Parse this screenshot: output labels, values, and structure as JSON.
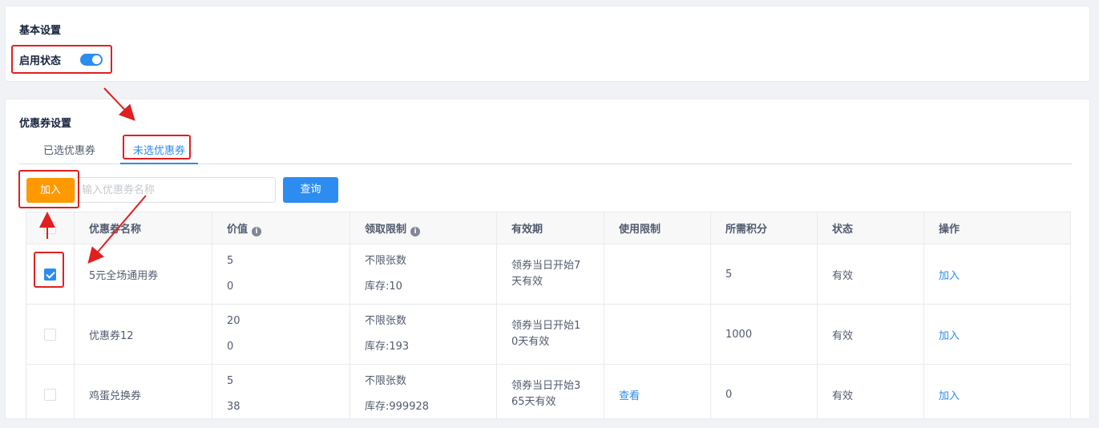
{
  "basic": {
    "title": "基本设置",
    "enable_label": "启用状态",
    "enabled": true
  },
  "coupon": {
    "title": "优惠券设置",
    "tabs": [
      {
        "label": "已选优惠券",
        "active": false
      },
      {
        "label": "未选优惠券",
        "active": true
      }
    ],
    "add_button": "加入",
    "search_placeholder": "输入优惠券名称",
    "query_button": "查询",
    "columns": [
      "优惠券名称",
      "价值",
      "领取限制",
      "有效期",
      "使用限制",
      "所需积分",
      "状态",
      "操作"
    ],
    "rows": [
      {
        "checked": true,
        "name": "5元全场通用券",
        "value1": "5",
        "value2": "0",
        "limit1": "不限张数",
        "limit2": "库存:10",
        "validity1": "领券当日开始7",
        "validity2": "天有效",
        "usage": "",
        "points": "5",
        "status": "有效",
        "action": "加入"
      },
      {
        "checked": false,
        "name": "优惠券12",
        "value1": "20",
        "value2": "0",
        "limit1": "不限张数",
        "limit2": "库存:193",
        "validity1": "领券当日开始1",
        "validity2": "0天有效",
        "usage": "",
        "points": "1000",
        "status": "有效",
        "action": "加入"
      },
      {
        "checked": false,
        "name": "鸡蛋兑换券",
        "value1": "5",
        "value2": "38",
        "limit1": "不限张数",
        "limit2": "库存:999928",
        "validity1": "领券当日开始3",
        "validity2": "65天有效",
        "usage": "查看",
        "points": "0",
        "status": "有效",
        "action": "加入"
      }
    ]
  },
  "colors": {
    "primary": "#2d8cf0",
    "warning": "#ff9900",
    "annotation": "#e02020"
  }
}
